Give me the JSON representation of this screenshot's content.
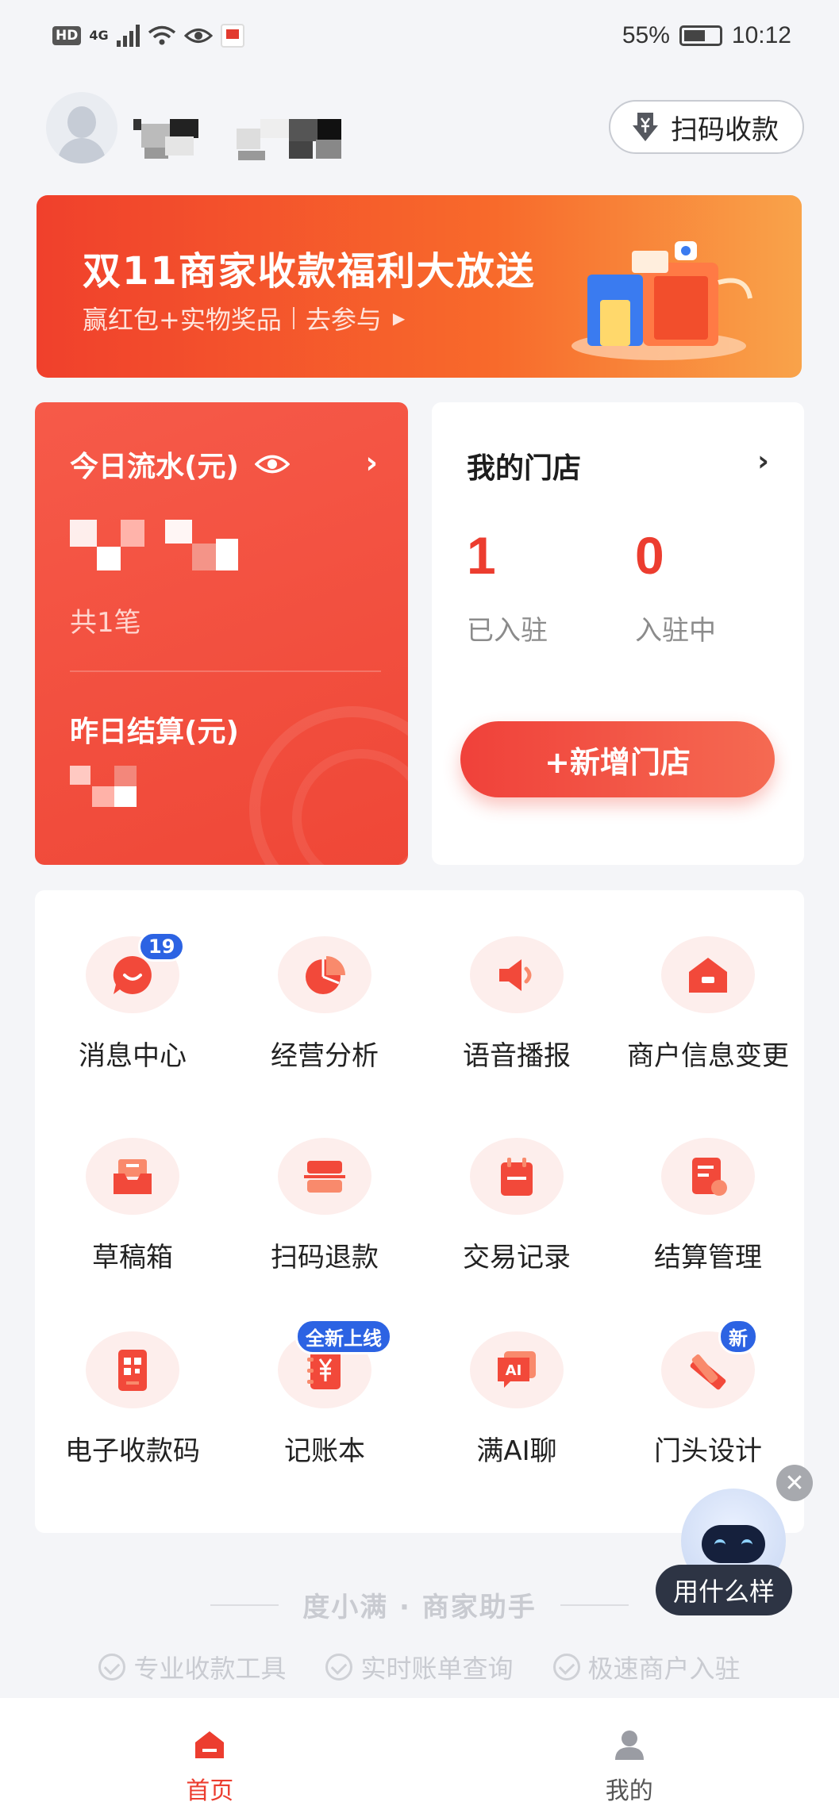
{
  "status_bar": {
    "hd": "HD",
    "network": "4G",
    "battery": "55%",
    "time": "10:12"
  },
  "header": {
    "scan_pay_label": "扫码收款"
  },
  "banner": {
    "title": "双11商家收款福利大放送",
    "subtitle": "赢红包+实物奖品",
    "cta": "去参与"
  },
  "revenue_card": {
    "today_label": "今日流水(元)",
    "count": "共1笔",
    "yesterday_label": "昨日结算(元)"
  },
  "store_card": {
    "title": "我的门店",
    "stats": [
      {
        "value": "1",
        "label": "已入驻"
      },
      {
        "value": "0",
        "label": "入驻中"
      }
    ],
    "add_button": "+新增门店"
  },
  "menu": {
    "items": [
      {
        "label": "消息中心",
        "icon": "message-icon",
        "badge": "19"
      },
      {
        "label": "经营分析",
        "icon": "pie-chart-icon"
      },
      {
        "label": "语音播报",
        "icon": "speaker-icon"
      },
      {
        "label": "商户信息变更",
        "icon": "store-icon"
      },
      {
        "label": "草稿箱",
        "icon": "inbox-icon"
      },
      {
        "label": "扫码退款",
        "icon": "scan-refund-icon"
      },
      {
        "label": "交易记录",
        "icon": "calendar-icon"
      },
      {
        "label": "结算管理",
        "icon": "settlement-icon"
      },
      {
        "label": "电子收款码",
        "icon": "qr-code-icon"
      },
      {
        "label": "记账本",
        "icon": "ledger-icon",
        "badge": "全新上线"
      },
      {
        "label": "满AI聊",
        "icon": "ai-chat-icon"
      },
      {
        "label": "门头设计",
        "icon": "design-icon",
        "badge": "新"
      }
    ]
  },
  "footer": {
    "brand": "度小满 · 商家助手",
    "features": [
      "专业收款工具",
      "实时账单查询",
      "极速商户入驻"
    ]
  },
  "assistant": {
    "bubble": "用什么样"
  },
  "bottom_nav": {
    "items": [
      {
        "label": "首页",
        "icon": "home-icon",
        "active": true
      },
      {
        "label": "我的",
        "icon": "profile-icon",
        "active": false
      }
    ]
  },
  "colors": {
    "accent": "#ef4737",
    "badge_blue": "#2c63e3",
    "icon_bg": "#fdeeec"
  }
}
